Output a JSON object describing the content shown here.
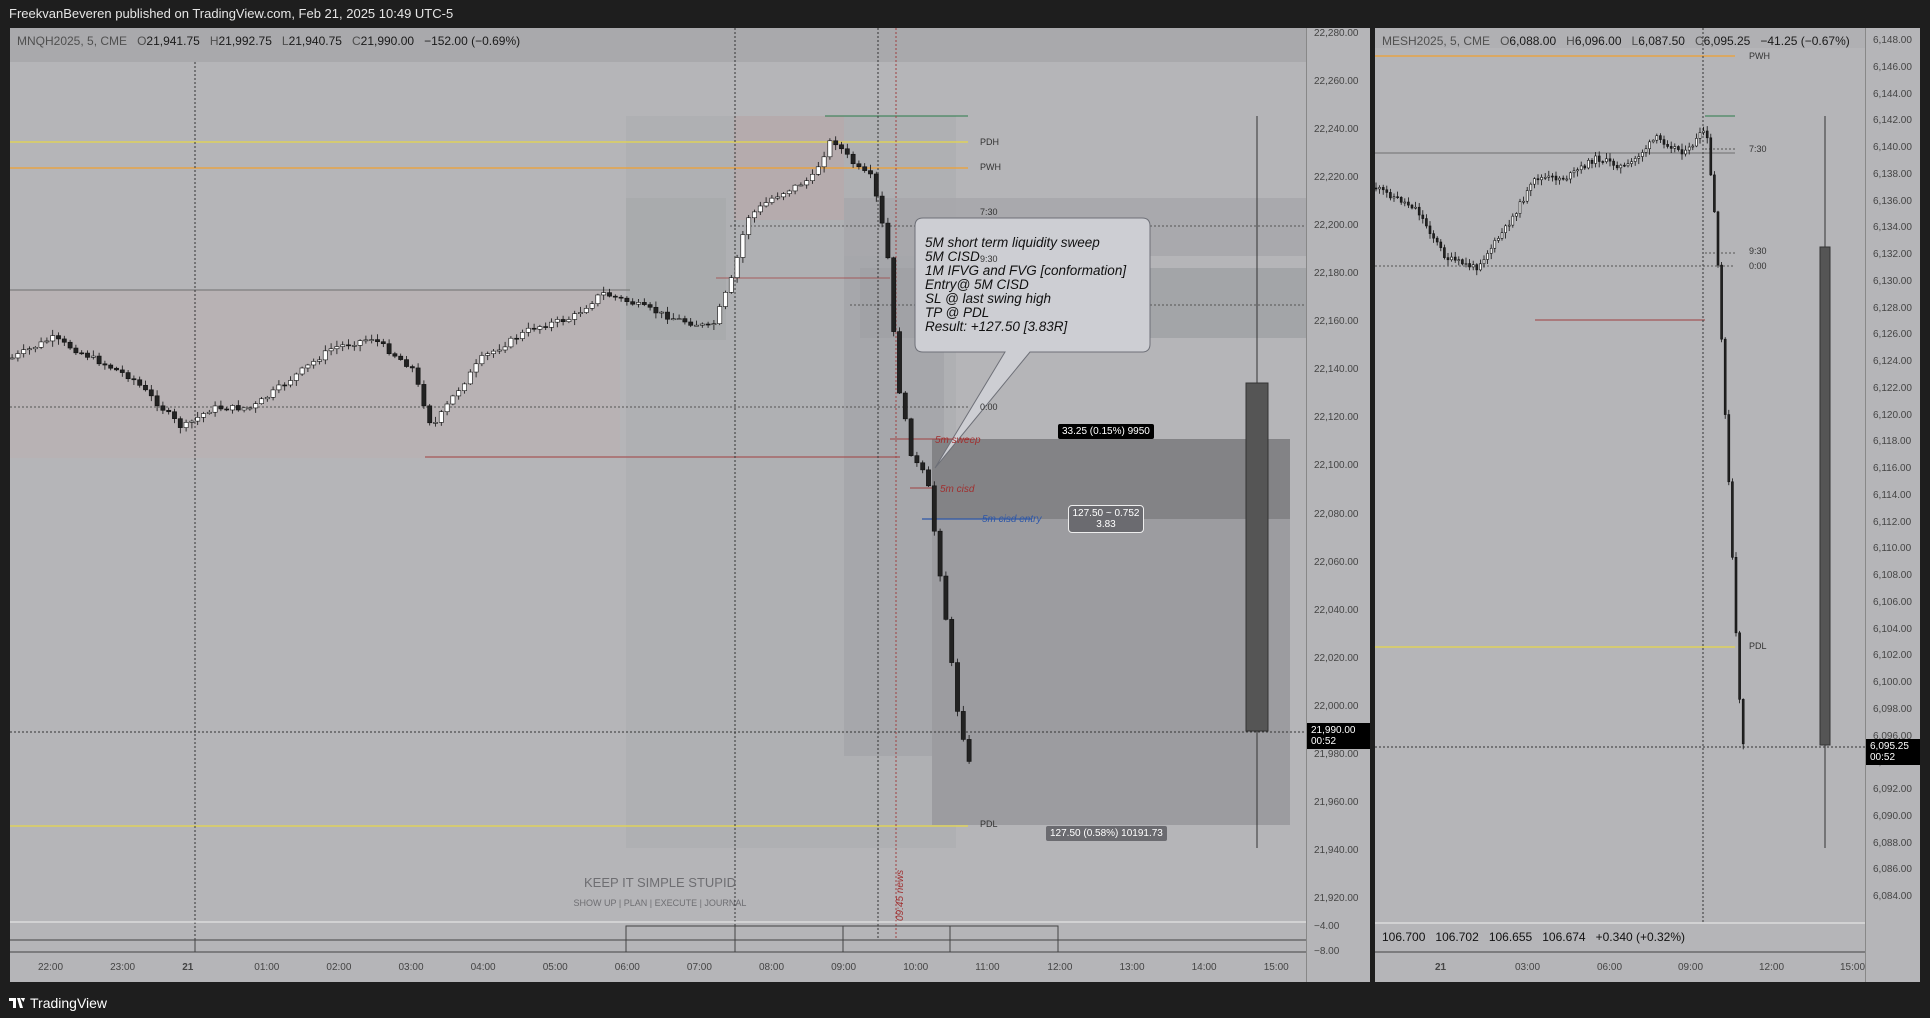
{
  "header": {
    "publish_line": "FreekvanBeveren published on TradingView.com, Feb 21, 2025 10:49 UTC-5"
  },
  "footer": {
    "brand": "TradingView"
  },
  "colors": {
    "bg": "#b5b5b8",
    "dark": "#1e1e1e",
    "yellow": "#e8d84a",
    "orange": "#f0a030",
    "red": "#b04040",
    "blue": "#2e57a8"
  },
  "left_chart": {
    "symbol": "MNQH2025, 5, CME",
    "ohlc": {
      "o_label": "O",
      "o": "21,941.75",
      "h_label": "H",
      "h": "21,992.75",
      "l_label": "L",
      "l": "21,940.75",
      "c_label": "C",
      "c": "21,990.00",
      "change": "−152.00 (−0.69%)"
    },
    "price_ticks": [
      "22,280.00",
      "22,260.00",
      "22,240.00",
      "22,220.00",
      "22,200.00",
      "22,180.00",
      "22,160.00",
      "22,140.00",
      "22,120.00",
      "22,100.00",
      "22,080.00",
      "22,060.00",
      "22,040.00",
      "22,020.00",
      "22,000.00",
      "21,980.00",
      "21,960.00",
      "21,940.00",
      "21,920.00"
    ],
    "osc_ticks": [
      "−4.00",
      "−8.00"
    ],
    "time_ticks": [
      "22:00",
      "23:00",
      "21",
      "01:00",
      "02:00",
      "03:00",
      "04:00",
      "05:00",
      "06:00",
      "07:00",
      "08:00",
      "09:00",
      "10:00",
      "11:00",
      "12:00",
      "13:00",
      "14:00",
      "15:00"
    ],
    "levels": {
      "pdh": "PDH",
      "pwh": "PWH",
      "open730": "7:30",
      "open930": "9:30",
      "midnight": "0:00",
      "pdl": "PDL"
    },
    "annotations": {
      "sweep": "5m sweep",
      "cisd": "5m cisd",
      "entry": "5m cisd entry",
      "news": "09:45 news"
    },
    "callout": [
      "5M short term liquidity sweep",
      "5M CISD",
      "1M IFVG and FVG [conformation]",
      "Entry@ 5M CISD",
      "SL @ last swing high",
      "TP @ PDL",
      "Result: +127.50 [3.83R]"
    ],
    "position": {
      "risk_label": "33.25 (0.15%) 9950",
      "rr_line1": "127.50 ~ 0.752",
      "rr_line2": "3.83",
      "target_label": "127.50 (0.58%) 10191.73"
    },
    "last_price": {
      "value": "21,990.00",
      "countdown": "00:52"
    },
    "watermark": {
      "title": "KEEP IT SIMPLE STUPID",
      "subtitle": "SHOW UP  |  PLAN  |  EXECUTE  |  JOURNAL"
    }
  },
  "right_chart": {
    "symbol": "MESH2025, 5, CME",
    "ohlc": {
      "o_label": "O",
      "o": "6,088.00",
      "h_label": "H",
      "h": "6,096.00",
      "l_label": "L",
      "l": "6,087.50",
      "c_label": "C",
      "c": "6,095.25",
      "change": "−41.25 (−0.67%)"
    },
    "price_ticks": [
      "6,148.00",
      "6,146.00",
      "6,144.00",
      "6,142.00",
      "6,140.00",
      "6,138.00",
      "6,136.00",
      "6,134.00",
      "6,132.00",
      "6,130.00",
      "6,128.00",
      "6,126.00",
      "6,124.00",
      "6,122.00",
      "6,120.00",
      "6,118.00",
      "6,116.00",
      "6,114.00",
      "6,112.00",
      "6,110.00",
      "6,108.00",
      "6,106.00",
      "6,104.00",
      "6,102.00",
      "6,100.00",
      "6,098.00",
      "6,096.00",
      "6,094.00",
      "6,092.00",
      "6,090.00",
      "6,088.00",
      "6,086.00",
      "6,084.00"
    ],
    "time_ticks": [
      "21",
      "03:00",
      "06:00",
      "09:00",
      "12:00",
      "15:00"
    ],
    "levels": {
      "pwh": "PWH",
      "open730": "7:30",
      "open930": "9:30",
      "midnight": "0:00",
      "pdl": "PDL"
    },
    "last_price": {
      "value": "6,095.25",
      "countdown": "00:52"
    },
    "osc_values": {
      "v1": "106.700",
      "v2": "106.702",
      "v3": "106.655",
      "v4": "106.674",
      "chg": "+0.340 (+0.32%)"
    }
  }
}
